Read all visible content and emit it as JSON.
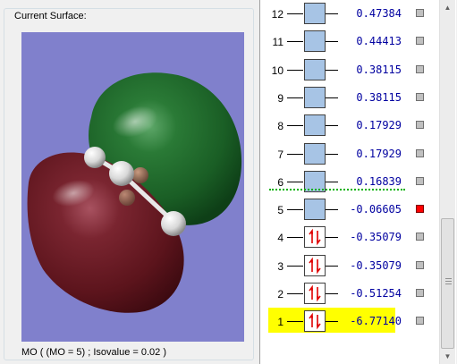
{
  "surface_group": {
    "title": "Current Surface:",
    "caption": "MO ( (MO = 5) ; Isovalue = 0.02 )"
  },
  "colors": {
    "viewport_bg": "#8080cc",
    "positive_lobe": "#1f6b2a",
    "negative_lobe": "#6e1a22",
    "virtual_box": "#a7c4e5",
    "highlight": "#ffff00",
    "energy_text": "#0000a0",
    "homo_lumo_divider": "#00b000"
  },
  "orbitals": [
    {
      "index": "12",
      "energy": " 0.47384",
      "occupied": false,
      "active": false,
      "highlight": false
    },
    {
      "index": "11",
      "energy": " 0.44413",
      "occupied": false,
      "active": false,
      "highlight": false
    },
    {
      "index": "10",
      "energy": " 0.38115",
      "occupied": false,
      "active": false,
      "highlight": false
    },
    {
      "index": "9",
      "energy": " 0.38115",
      "occupied": false,
      "active": false,
      "highlight": false
    },
    {
      "index": "8",
      "energy": " 0.17929",
      "occupied": false,
      "active": false,
      "highlight": false
    },
    {
      "index": "7",
      "energy": " 0.17929",
      "occupied": false,
      "active": false,
      "highlight": false
    },
    {
      "index": "6",
      "energy": " 0.16839",
      "occupied": false,
      "active": false,
      "highlight": false
    },
    {
      "index": "5",
      "energy": "-0.06605",
      "occupied": false,
      "active": true,
      "highlight": false
    },
    {
      "index": "4",
      "energy": "-0.35079",
      "occupied": true,
      "active": false,
      "highlight": false
    },
    {
      "index": "3",
      "energy": "-0.35079",
      "occupied": true,
      "active": false,
      "highlight": false
    },
    {
      "index": "2",
      "energy": "-0.51254",
      "occupied": true,
      "active": false,
      "highlight": false
    },
    {
      "index": "1",
      "energy": "-6.77140",
      "occupied": true,
      "active": false,
      "highlight": true
    }
  ],
  "icons": {
    "occupied": "electron-pair-arrows-icon",
    "scroll_up": "scroll-up-arrow-icon",
    "scroll_down": "scroll-down-arrow-icon"
  }
}
